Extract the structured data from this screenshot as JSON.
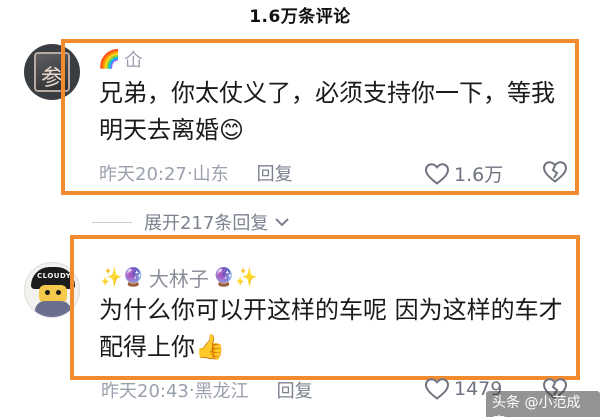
{
  "header": {
    "title": "1.6万条评论"
  },
  "comments": [
    {
      "username_emoji_left": "🌈",
      "username": "仚",
      "text_line1": "兄弟，你太仗义了，必须支持你一下，等我",
      "text_line2": "明天去离婚😊",
      "time": "昨天20:27",
      "separator": " · ",
      "location": "山东",
      "reply_label": "回复",
      "likes": "1.6万"
    },
    {
      "username_emoji_left": "✨🔮",
      "username": "大林子",
      "username_emoji_right": "🔮✨",
      "avatar_hat_text": "CLOUDY",
      "text_line1": "为什么你可以开这样的车呢 因为这样的车才",
      "text_line2": "配得上你👍",
      "time": "昨天20:43",
      "separator": " · ",
      "location": "黑龙江",
      "reply_label": "回复",
      "likes": "1479"
    }
  ],
  "expand": {
    "label": "展开217条回复"
  },
  "watermark": {
    "text": "头条 @小范成章"
  },
  "colors": {
    "highlight": "#f28a2e",
    "meta": "#9aa0ad",
    "text": "#1a1a1a"
  },
  "icons": [
    "heart-outline-icon",
    "broken-heart-icon",
    "chevron-down-icon"
  ]
}
